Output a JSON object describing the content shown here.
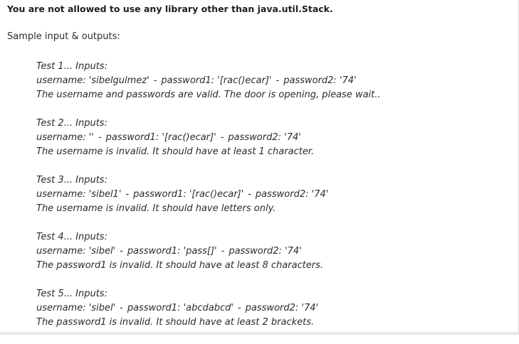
{
  "notice": "You are not allowed to use any library other than java.util.Stack.",
  "sample_heading": "Sample input & outputs:",
  "tests": [
    {
      "header": "Test 1... Inputs:",
      "username": "username: 'sibelgulmez'",
      "password1": "password1: '[rac()ecar]'",
      "password2": "password2: '74'",
      "result": "The username and passwords are valid. The door is opening, please wait.."
    },
    {
      "header": "Test 2... Inputs:",
      "username": "username: ''",
      "password1": "password1: '[rac()ecar]'",
      "password2": "password2: '74'",
      "result": "The username is invalid. It should have at least 1 character."
    },
    {
      "header": "Test 3... Inputs:",
      "username": "username: 'sibel1'",
      "password1": "password1: '[rac()ecar]'",
      "password2": "password2: '74'",
      "result": "The username is invalid. It should have letters only."
    },
    {
      "header": "Test 4... Inputs:",
      "username": "username: 'sibel'",
      "password1": "password1: 'pass[]'",
      "password2": "password2: '74'",
      "result": "The password1 is invalid. It should have at least 8 characters."
    },
    {
      "header": "Test 5... Inputs:",
      "username": "username: 'sibel'",
      "password1": "password1: 'abcdabcd'",
      "password2": "password2: '74'",
      "result": "The password1 is invalid. It should have at least 2 brackets."
    }
  ]
}
